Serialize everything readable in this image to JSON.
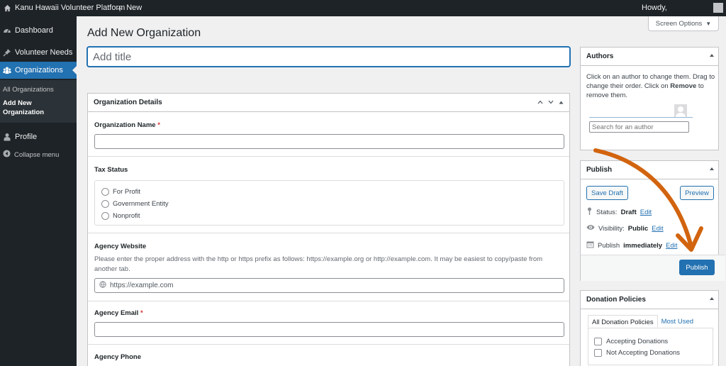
{
  "admin_bar": {
    "site_name": "Kanu Hawaii Volunteer Platform",
    "new_label": "New",
    "howdy": "Howdy,"
  },
  "sidebar": {
    "items": [
      {
        "label": "Dashboard",
        "icon": "dashboard-icon"
      },
      {
        "label": "Volunteer Needs",
        "icon": "pin-icon"
      },
      {
        "label": "Organizations",
        "icon": "groups-icon"
      },
      {
        "label": "Profile",
        "icon": "user-icon"
      }
    ],
    "submenu": [
      "All Organizations",
      "Add New Organization"
    ],
    "collapse_label": "Collapse menu"
  },
  "page": {
    "title": "Add New Organization",
    "screen_options": "Screen Options",
    "title_placeholder": "Add title"
  },
  "org_details": {
    "heading": "Organization Details",
    "name_label": "Organization Name",
    "tax_label": "Tax Status",
    "tax_options": [
      "For Profit",
      "Government Entity",
      "Nonprofit"
    ],
    "website_label": "Agency Website",
    "website_help": "Please enter the proper address with the http or https prefix as follows: https://example.org or http://example.com. It may be easiest to copy/paste from another tab.",
    "website_placeholder": "https://example.com",
    "email_label": "Agency Email",
    "phone_label": "Agency Phone",
    "required_mark": "*"
  },
  "authors": {
    "heading": "Authors",
    "description_pre": "Click on an author to change them. Drag to change their order. Click on ",
    "description_bold": "Remove",
    "description_post": " to remove them.",
    "search_placeholder": "Search for an author"
  },
  "publish": {
    "heading": "Publish",
    "save_draft": "Save Draft",
    "preview": "Preview",
    "status_label": "Status:",
    "status_value": "Draft",
    "visibility_label": "Visibility:",
    "visibility_value": "Public",
    "schedule_label": "Publish",
    "schedule_value": "immediately",
    "edit": "Edit",
    "publish_button": "Publish"
  },
  "donation_policies": {
    "heading": "Donation Policies",
    "tab_all": "All Donation Policies",
    "tab_used": "Most Used",
    "options": [
      "Accepting Donations",
      "Not Accepting Donations"
    ]
  },
  "colors": {
    "accent": "#2271b1",
    "admin_bar": "#1d2327",
    "annotation_arrow": "#d2640f"
  }
}
